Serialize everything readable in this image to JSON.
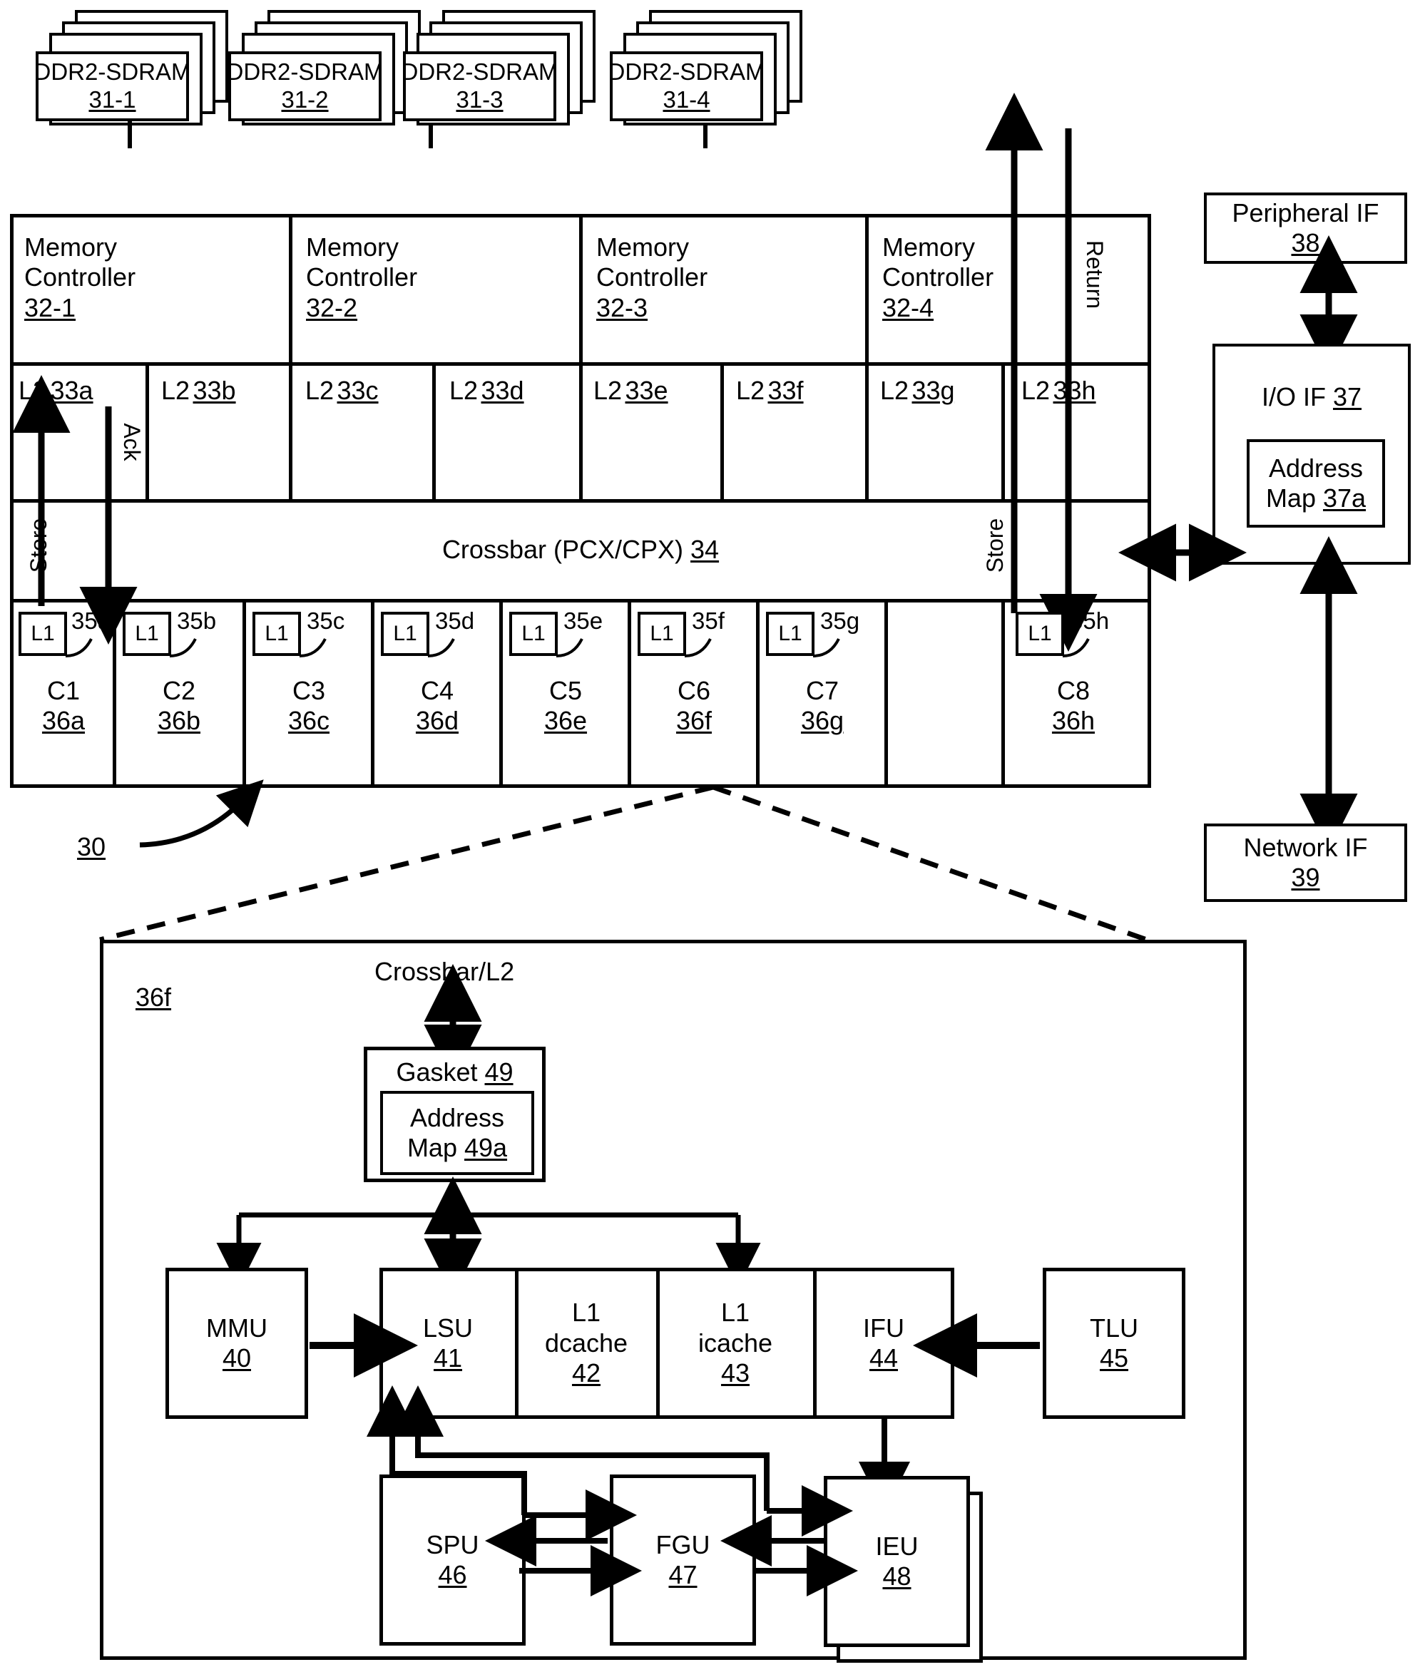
{
  "figure": {
    "system_ref": "30",
    "detail_ref": "36f"
  },
  "dram": {
    "label": "DDR2-SDRAM",
    "items": [
      {
        "label": "DDR2-SDRAM",
        "ref": "31-1"
      },
      {
        "label": "DDR2-SDRAM",
        "ref": "31-2"
      },
      {
        "label": "DDR2-SDRAM",
        "ref": "31-3"
      },
      {
        "label": "DDR2-SDRAM",
        "ref": "31-4"
      }
    ]
  },
  "memory_controllers": [
    {
      "line1": "Memory",
      "line2": "Controller",
      "ref": "32-1"
    },
    {
      "line1": "Memory",
      "line2": "Controller",
      "ref": "32-2"
    },
    {
      "line1": "Memory",
      "line2": "Controller",
      "ref": "32-3"
    },
    {
      "line1": "Memory",
      "line2": "Controller",
      "ref": "32-4"
    }
  ],
  "l2_banks": [
    {
      "label": "L2",
      "ref": "33a"
    },
    {
      "label": "L2",
      "ref": "33b"
    },
    {
      "label": "L2",
      "ref": "33c"
    },
    {
      "label": "L2",
      "ref": "33d"
    },
    {
      "label": "L2",
      "ref": "33e"
    },
    {
      "label": "L2",
      "ref": "33f"
    },
    {
      "label": "L2",
      "ref": "33g"
    },
    {
      "label": "L2",
      "ref": "33h"
    }
  ],
  "crossbar": {
    "label": "Crossbar (PCX/CPX)",
    "ref": "34"
  },
  "cores": [
    {
      "l1": "L1",
      "l1_ref": "35a",
      "name": "C1",
      "ref": "36a"
    },
    {
      "l1": "L1",
      "l1_ref": "35b",
      "name": "C2",
      "ref": "36b"
    },
    {
      "l1": "L1",
      "l1_ref": "35c",
      "name": "C3",
      "ref": "36c"
    },
    {
      "l1": "L1",
      "l1_ref": "35d",
      "name": "C4",
      "ref": "36d"
    },
    {
      "l1": "L1",
      "l1_ref": "35e",
      "name": "C5",
      "ref": "36e"
    },
    {
      "l1": "L1",
      "l1_ref": "35f",
      "name": "C6",
      "ref": "36f"
    },
    {
      "l1": "L1",
      "l1_ref": "35g",
      "name": "C7",
      "ref": "36g"
    },
    {
      "l1": "L1",
      "l1_ref": "35h",
      "name": "C8",
      "ref": "36h"
    }
  ],
  "flow_labels": {
    "store_left": "Store",
    "ack": "Ack",
    "return": "Return",
    "store_right": "Store"
  },
  "io": {
    "peripheral": {
      "label": "Peripheral IF",
      "ref": "38"
    },
    "io_if": {
      "label": "I/O IF",
      "ref": "37"
    },
    "address_map": {
      "line1": "Address",
      "line2": "Map",
      "ref": "37a"
    },
    "network": {
      "label": "Network IF",
      "ref": "39"
    }
  },
  "detail": {
    "crossbar_l2": "Crossbar/L2",
    "gasket": {
      "label": "Gasket",
      "ref": "49"
    },
    "address_map": {
      "line1": "Address",
      "line2": "Map",
      "ref": "49a"
    },
    "units": [
      {
        "name": "MMU",
        "ref": "40"
      },
      {
        "name": "LSU",
        "ref": "41"
      },
      {
        "name": "L1",
        "name2": "dcache",
        "ref": "42"
      },
      {
        "name": "L1",
        "name2": "icache",
        "ref": "43"
      },
      {
        "name": "IFU",
        "ref": "44"
      },
      {
        "name": "TLU",
        "ref": "45"
      },
      {
        "name": "SPU",
        "ref": "46"
      },
      {
        "name": "FGU",
        "ref": "47"
      },
      {
        "name": "IEU",
        "ref": "48"
      }
    ]
  },
  "colors": {
    "ink": "#000000",
    "paper": "#ffffff"
  }
}
